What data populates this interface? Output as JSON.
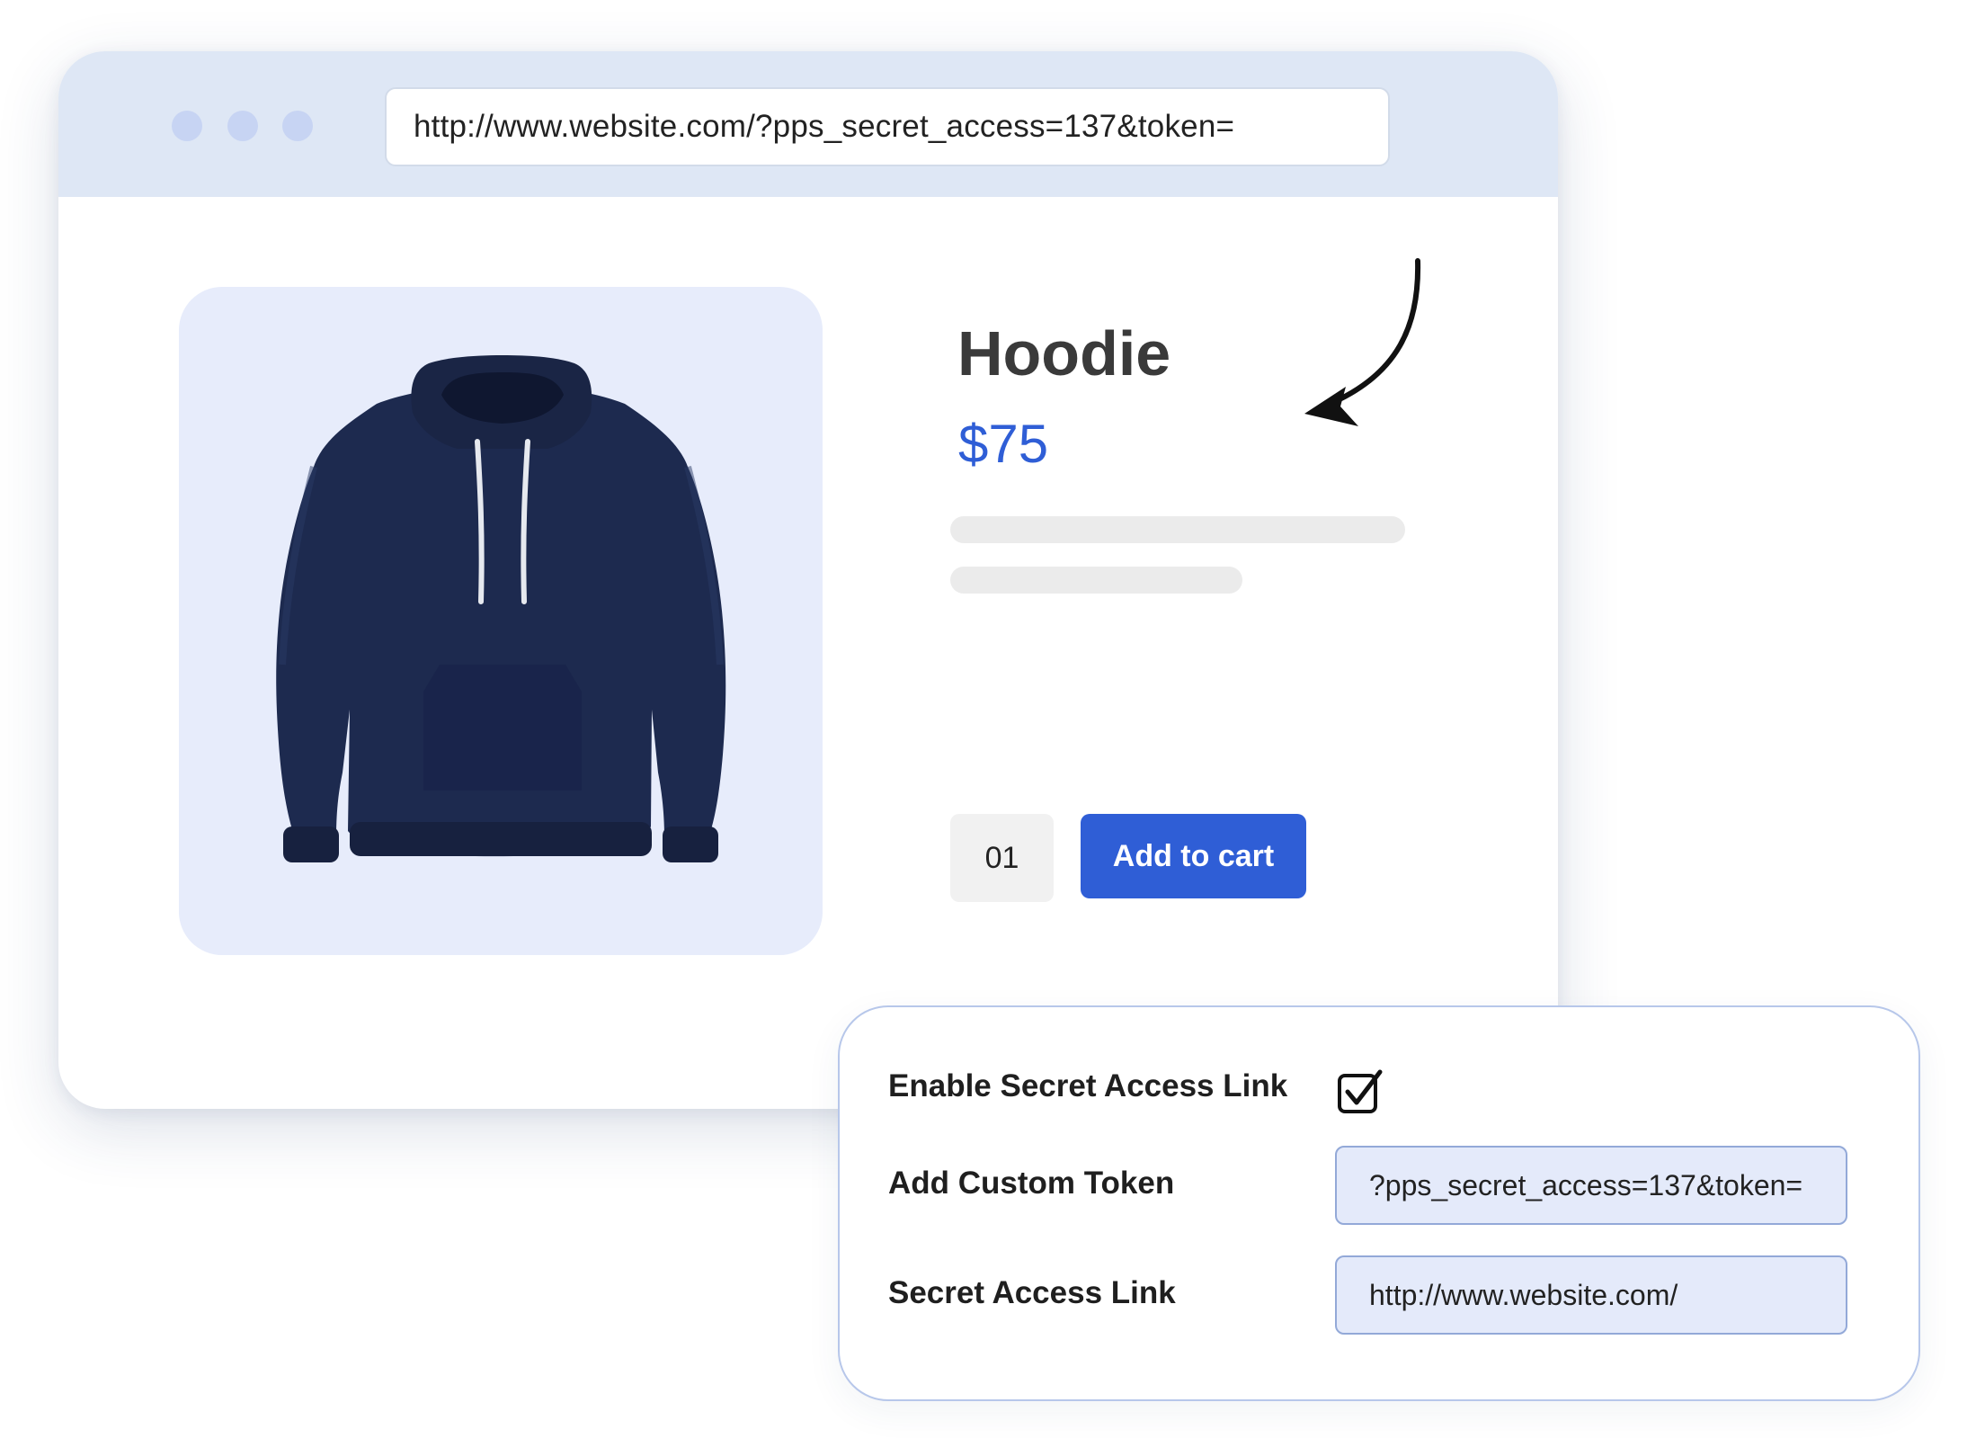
{
  "browser": {
    "window_controls": [
      "dot",
      "dot",
      "dot"
    ],
    "url": "http://www.website.com/?pps_secret_access=137&token="
  },
  "product": {
    "image_icon": "hoodie-product-image",
    "title": "Hoodie",
    "price": "$75",
    "quantity": "01",
    "add_to_cart_label": "Add to cart"
  },
  "settings": {
    "enable_label": "Enable Secret Access Link",
    "enable_checked": true,
    "token_label": "Add Custom Token",
    "token_value": "?pps_secret_access=137&token=",
    "link_label": "Secret Access Link",
    "link_value": "http://www.website.com/"
  },
  "colors": {
    "accent": "#2f5ed6",
    "browser_bar": "#dee7f5",
    "image_panel": "#e7ecfb",
    "field_bg": "#e4eafa",
    "card_border": "#b7c7ea",
    "hoodie": "#1d2a4f"
  }
}
